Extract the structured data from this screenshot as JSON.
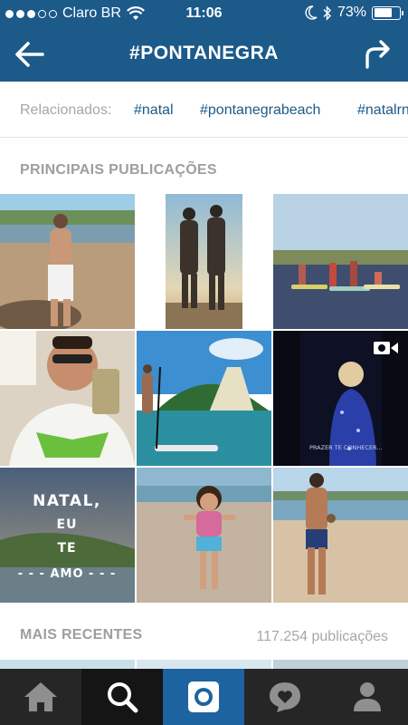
{
  "status_bar": {
    "carrier": "Claro BR",
    "time": "11:06",
    "battery": "73%",
    "battery_level": 0.73
  },
  "header": {
    "title": "#PONTANEGRA",
    "back_icon": "back-arrow-icon",
    "share_icon": "share-arrow-icon"
  },
  "related": {
    "label": "Relacionados:",
    "tags": [
      "#natal",
      "#pontanegrabeach",
      "#natalrn"
    ]
  },
  "top_posts": {
    "title": "PRINCIPAIS PUBLICAÇÕES",
    "posts": [
      {
        "overlay": ""
      },
      {
        "overlay": ""
      },
      {
        "overlay": ""
      },
      {
        "overlay": ""
      },
      {
        "overlay": "",
        "video_icon": "video-camera-icon",
        "caption": "PRAZER TE CONHECER..."
      },
      {
        "overlay": ""
      },
      {
        "overlay": "",
        "caption_lines": [
          "NATAL,",
          "EU",
          "TE",
          "- - - AMO - - -"
        ]
      },
      {
        "overlay": ""
      },
      {
        "overlay": ""
      }
    ]
  },
  "recent": {
    "title": "MAIS RECENTES",
    "count": "117.254 publicações"
  },
  "tab_bar": {
    "tabs": [
      "home-icon",
      "search-icon",
      "camera-icon",
      "activity-heart-icon",
      "profile-icon"
    ]
  },
  "colors": {
    "header_blue": "#1c5a8a",
    "tag_blue": "#1c5a8a",
    "tab_active": "#1d63a0"
  }
}
